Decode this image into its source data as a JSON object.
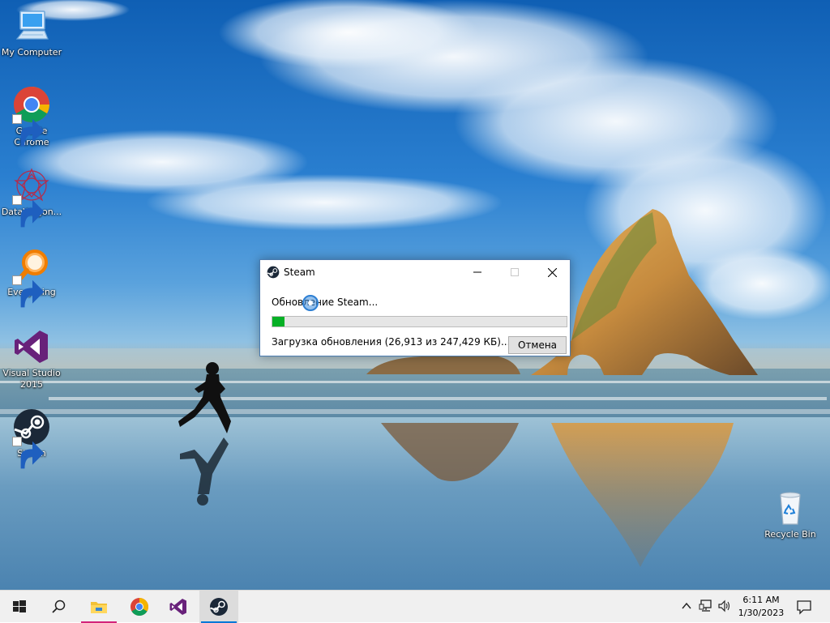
{
  "desktop": {
    "icons": [
      {
        "label": "My Computer"
      },
      {
        "label": "Google Chrome"
      },
      {
        "label": "DataWagon..."
      },
      {
        "label": "Everything"
      },
      {
        "label": "Visual Studio 2015"
      },
      {
        "label": "Steam"
      },
      {
        "label": "Recycle Bin"
      }
    ]
  },
  "dialog": {
    "title": "Steam",
    "status": "Обновление Steam...",
    "progress_fraction": 0.04,
    "download_text": "Загрузка обновления (26,913 из 247,429 КБ)...",
    "cancel_label": "Отмена",
    "progress_color": "#06b025"
  },
  "taskbar": {
    "pinned": [
      "start-icon",
      "search-icon",
      "file-explorer-icon",
      "chrome-icon",
      "visual-studio-icon",
      "steam-icon"
    ],
    "active": "steam",
    "clock": {
      "time": "6:11 AM",
      "date": "1/30/2023"
    },
    "accent_color": "#0078d7"
  }
}
